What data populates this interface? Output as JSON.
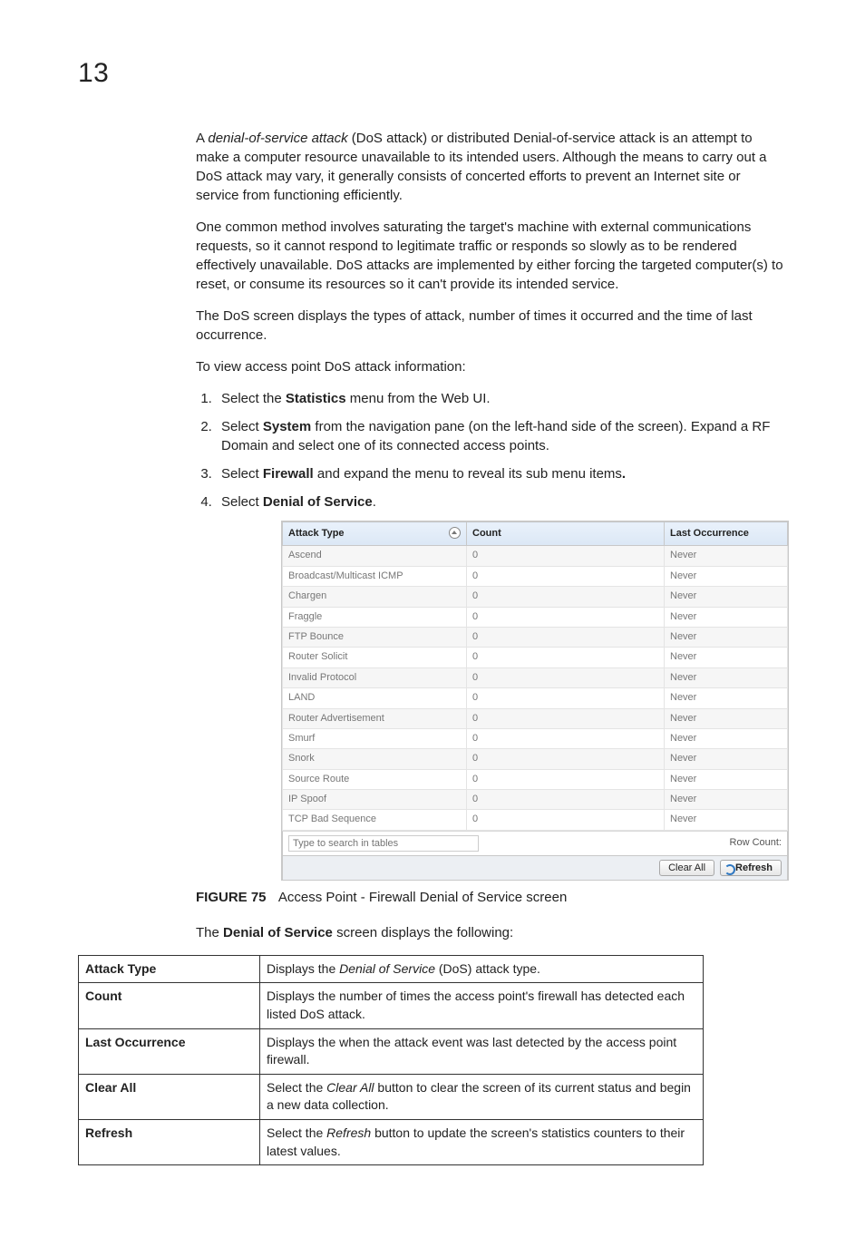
{
  "page_number": "13",
  "paragraphs": {
    "p1_lead_italic": "denial-of-service attack",
    "p1_a": "A ",
    "p1_b": " (DoS attack) or distributed Denial-of-service attack is an attempt to make a computer resource unavailable to its intended users. Although the means to carry out a DoS attack may vary, it generally consists of concerted efforts to prevent an Internet site or service from functioning efficiently.",
    "p2": "One common method involves saturating the target's machine with external communications requests, so it cannot respond to legitimate traffic or responds so slowly as to be rendered effectively unavailable. DoS attacks are implemented by either forcing the targeted computer(s) to reset, or consume its resources so it can't provide its intended service.",
    "p3": "The DoS screen displays the types of attack, number of times it occurred and the time of last occurrence.",
    "p4": "To view access point DoS attack information:"
  },
  "steps": [
    {
      "pre": "Select the ",
      "bold": "Statistics",
      "post": " menu from the Web UI."
    },
    {
      "pre": "Select ",
      "bold": "System",
      "post": " from the navigation pane (on the left-hand side of the screen). Expand a RF Domain and select one of its connected access points."
    },
    {
      "pre": "Select ",
      "bold": "Firewall",
      "post": " and expand the menu to reveal its sub menu items",
      "trailing_bold": "."
    },
    {
      "pre": "Select ",
      "bold": "Denial of Service",
      "post": "."
    }
  ],
  "screenshot": {
    "columns": [
      "Attack Type",
      "Count",
      "Last Occurrence"
    ],
    "rows": [
      {
        "attack": "Ascend",
        "count": "0",
        "last": "Never"
      },
      {
        "attack": "Broadcast/Multicast ICMP",
        "count": "0",
        "last": "Never"
      },
      {
        "attack": "Chargen",
        "count": "0",
        "last": "Never"
      },
      {
        "attack": "Fraggle",
        "count": "0",
        "last": "Never"
      },
      {
        "attack": "FTP Bounce",
        "count": "0",
        "last": "Never"
      },
      {
        "attack": "Router Solicit",
        "count": "0",
        "last": "Never"
      },
      {
        "attack": "Invalid Protocol",
        "count": "0",
        "last": "Never"
      },
      {
        "attack": "LAND",
        "count": "0",
        "last": "Never"
      },
      {
        "attack": "Router Advertisement",
        "count": "0",
        "last": "Never"
      },
      {
        "attack": "Smurf",
        "count": "0",
        "last": "Never"
      },
      {
        "attack": "Snork",
        "count": "0",
        "last": "Never"
      },
      {
        "attack": "Source Route",
        "count": "0",
        "last": "Never"
      },
      {
        "attack": "IP Spoof",
        "count": "0",
        "last": "Never"
      },
      {
        "attack": "TCP Bad Sequence",
        "count": "0",
        "last": "Never"
      }
    ],
    "search_placeholder": "Type to search in tables",
    "row_count_label": "Row Count:",
    "buttons": {
      "clear_all": "Clear All",
      "refresh": "Refresh"
    }
  },
  "figure": {
    "label": "FIGURE 75",
    "caption": "Access Point - Firewall Denial of Service screen"
  },
  "desc_intro": {
    "pre": "The ",
    "bold": "Denial of Service",
    "post": " screen displays the following:"
  },
  "desc_table": [
    {
      "term": "Attack Type",
      "pre": "Displays the ",
      "italic": "Denial of Service",
      "post": " (DoS) attack type."
    },
    {
      "term": "Count",
      "plain": "Displays the number of times the access point's firewall has detected each listed DoS attack."
    },
    {
      "term": "Last Occurrence",
      "plain": "Displays the when the attack event was last detected by the access point firewall."
    },
    {
      "term": "Clear All",
      "pre": "Select the ",
      "italic": "Clear All",
      "post": " button to clear the screen of its current status and begin a new data collection."
    },
    {
      "term": "Refresh",
      "pre": "Select the ",
      "italic": "Refresh",
      "post": " button to update the screen's statistics counters to their latest values."
    }
  ]
}
